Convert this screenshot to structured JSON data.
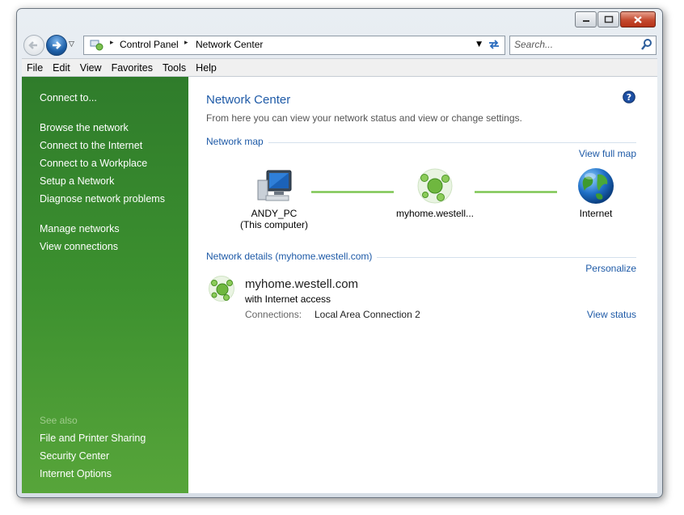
{
  "address": {
    "crumbs": [
      "Control Panel",
      "Network Center"
    ]
  },
  "search": {
    "placeholder": "Search..."
  },
  "menu": [
    "File",
    "Edit",
    "View",
    "Favorites",
    "Tools",
    "Help"
  ],
  "sidebar": {
    "tasks": [
      "Connect to...",
      "Browse the network",
      "Connect to the Internet",
      "Connect to a Workplace",
      "Setup a Network",
      "Diagnose network problems",
      "Manage networks",
      "View connections"
    ],
    "see_also_heading": "See also",
    "see_also": [
      "File and Printer Sharing",
      "Security Center",
      "Internet Options"
    ]
  },
  "main": {
    "title": "Network Center",
    "subtitle": "From here you can view your network status and view or change settings.",
    "map_heading": "Network map",
    "view_full_map": "View full map",
    "nodes": {
      "computer_name": "ANDY_PC",
      "computer_sub": "(This computer)",
      "network": "myhome.westell...",
      "internet": "Internet"
    },
    "details_heading": "Network details (myhome.westell.com)",
    "personalize": "Personalize",
    "network_name": "myhome.westell.com",
    "network_access": "with Internet access",
    "connections_label": "Connections:",
    "connections_value": "Local Area Connection 2",
    "view_status": "View status"
  },
  "colors": {
    "sidebar_top": "#2f7c2b",
    "sidebar_bottom": "#57a53a",
    "link_blue": "#1e5aa7"
  }
}
